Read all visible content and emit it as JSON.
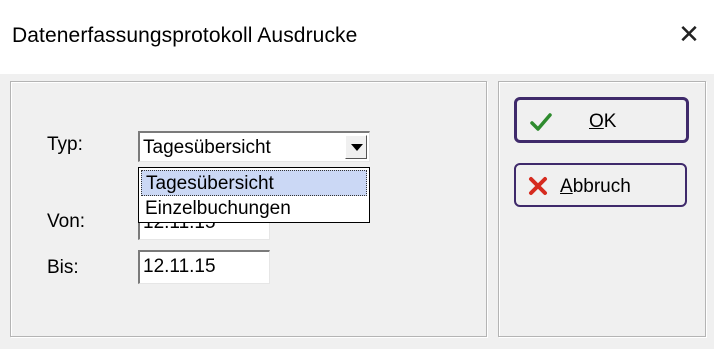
{
  "window": {
    "title": "Datenerfassungsprotokoll Ausdrucke",
    "close_glyph": "✕"
  },
  "form": {
    "typ_label": "Typ:",
    "typ_value": "Tagesübersicht",
    "von_label": "Von:",
    "von_value": "12.11.15",
    "bis_label": "Bis:",
    "bis_value": "12.11.15"
  },
  "dropdown": {
    "options": [
      "Tagesübersicht",
      "Einzelbuchungen"
    ],
    "selected_index": 0
  },
  "buttons": {
    "ok": {
      "mnemonic": "O",
      "rest": "K",
      "icon": "checkmark-icon",
      "icon_color": "#2e8b2e"
    },
    "cancel": {
      "mnemonic": "A",
      "rest": "bbruch",
      "icon": "cross-icon",
      "icon_color": "#d62b1f"
    }
  }
}
